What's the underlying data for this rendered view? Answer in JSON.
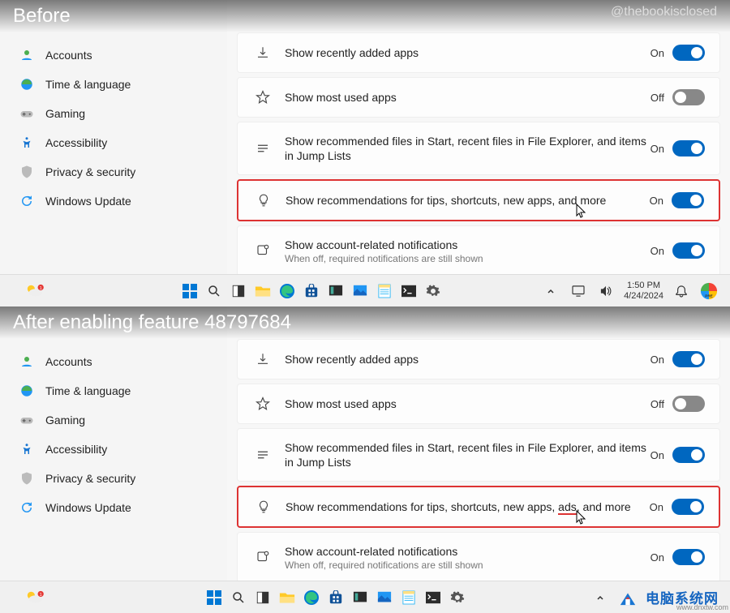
{
  "captions": {
    "before": "Before",
    "after": "After enabling feature 48797684",
    "handle": "@thebookisclosed"
  },
  "sidebar": {
    "items": [
      {
        "label": "Accounts",
        "icon": "accounts"
      },
      {
        "label": "Time & language",
        "icon": "time"
      },
      {
        "label": "Gaming",
        "icon": "gaming"
      },
      {
        "label": "Accessibility",
        "icon": "accessibility"
      },
      {
        "label": "Privacy & security",
        "icon": "privacy"
      },
      {
        "label": "Windows Update",
        "icon": "update"
      }
    ]
  },
  "settings_before": [
    {
      "title": "Show recently added apps",
      "sub": "",
      "state": "On",
      "on": true,
      "icon": "download"
    },
    {
      "title": "Show most used apps",
      "sub": "",
      "state": "Off",
      "on": false,
      "icon": "star"
    },
    {
      "title": "Show recommended files in Start, recent files in File Explorer, and items in Jump Lists",
      "sub": "",
      "state": "On",
      "on": true,
      "icon": "list"
    },
    {
      "title": "Show recommendations for tips, shortcuts, new apps, and more",
      "sub": "",
      "state": "On",
      "on": true,
      "icon": "bulb",
      "highlight": true
    },
    {
      "title": "Show account-related notifications",
      "sub": "When off, required notifications are still shown",
      "state": "On",
      "on": true,
      "icon": "square"
    }
  ],
  "settings_after": [
    {
      "title": "Show recently added apps",
      "sub": "",
      "state": "On",
      "on": true,
      "icon": "download"
    },
    {
      "title": "Show most used apps",
      "sub": "",
      "state": "Off",
      "on": false,
      "icon": "star"
    },
    {
      "title": "Show recommended files in Start, recent files in File Explorer, and items in Jump Lists",
      "sub": "",
      "state": "On",
      "on": true,
      "icon": "list"
    },
    {
      "title_parts": [
        "Show recommendations for tips, shortcuts, new apps, ",
        "ads",
        ", and more"
      ],
      "sub": "",
      "state": "On",
      "on": true,
      "icon": "bulb",
      "highlight": true,
      "ads": true
    },
    {
      "title": "Show account-related notifications",
      "sub": "When off, required notifications are still shown",
      "state": "On",
      "on": true,
      "icon": "square"
    }
  ],
  "taskbar": {
    "time": "1:50 PM",
    "date": "4/24/2024"
  },
  "watermark": "www.dnxtw.com"
}
